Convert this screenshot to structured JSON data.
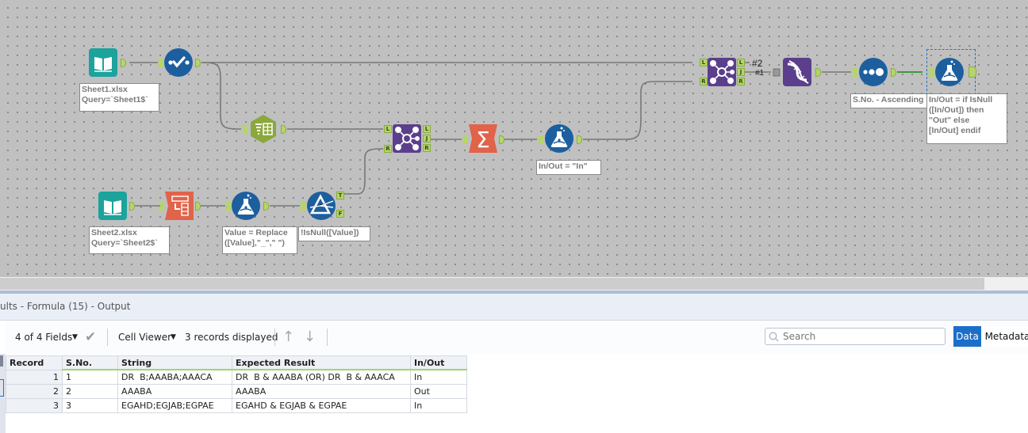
{
  "canvas": {
    "tools": [
      {
        "id": "input1",
        "type": "input-data",
        "annotation": "Sheet1.xlsx\nQuery=`Sheet1$`",
        "color": "#1ba39c"
      },
      {
        "id": "select1",
        "type": "select",
        "color": "#1d5f9e"
      },
      {
        "id": "text-to-columns1",
        "type": "text-to-columns",
        "color": "#8aa83c"
      },
      {
        "id": "join1",
        "type": "join",
        "color": "#5b3f8c"
      },
      {
        "id": "summarize1",
        "type": "summarize",
        "color": "#e0634a"
      },
      {
        "id": "formula1",
        "type": "formula",
        "annotation": "In/Out = \"In\"",
        "color": "#1d5f9e"
      },
      {
        "id": "join2",
        "type": "join",
        "color": "#5b3f8c"
      },
      {
        "id": "union1",
        "type": "union",
        "color": "#5b3f8c"
      },
      {
        "id": "sort1",
        "type": "sort",
        "annotation": "S.No. - Ascending",
        "color": "#1d5f9e"
      },
      {
        "id": "formula3",
        "type": "formula",
        "annotation": "In/Out = if IsNull\n([In/Out]) then\n\"Out\" else\n[In/Out] endif",
        "color": "#1d5f9e",
        "selected": true
      },
      {
        "id": "input2",
        "type": "input-data",
        "annotation": "Sheet2.xlsx\nQuery=`Sheet2$`",
        "color": "#1ba39c"
      },
      {
        "id": "transpose1",
        "type": "transpose",
        "color": "#e0634a"
      },
      {
        "id": "formula2",
        "type": "formula",
        "annotation": "Value = Replace\n([Value],\"_\",\" \")",
        "color": "#1d5f9e"
      },
      {
        "id": "filter1",
        "type": "filter",
        "annotation": "!IsNull([Value])",
        "color": "#1d5f9e"
      }
    ],
    "anchor_labels": {
      "left": "L",
      "join": "J",
      "right": "R",
      "true": "T",
      "false": "F"
    },
    "wire_labels": {
      "union_input_2": "#2",
      "union_input_1": "#1"
    }
  },
  "results": {
    "title": "ults - Formula (15) - Output",
    "toolbar": {
      "fields_label": "4 of 4 Fields",
      "cell_viewer_label": "Cell Viewer",
      "records_label": "3 records displayed",
      "search_placeholder": "Search",
      "data_tab": "Data",
      "metadata_tab": "Metadata"
    },
    "table": {
      "columns": [
        "Record",
        "S.No.",
        "String",
        "Expected Result",
        "In/Out"
      ],
      "rows": [
        [
          "1",
          "1",
          "DR  B;AAABA;AAACA",
          "DR  B & AAABA (OR) DR  B & AAACA",
          "In"
        ],
        [
          "2",
          "2",
          "AAABA",
          "AAABA",
          "Out"
        ],
        [
          "3",
          "3",
          "EGAHD;EGJAB;EGPAE",
          "EGAHD & EGJAB & EGPAE",
          "In"
        ]
      ]
    }
  }
}
